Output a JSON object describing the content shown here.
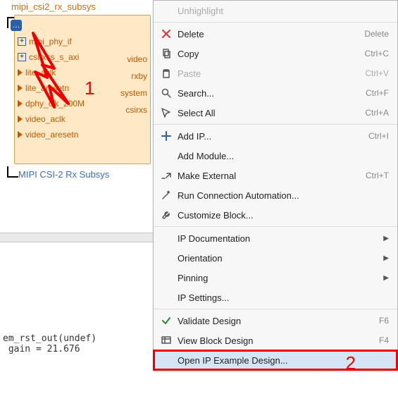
{
  "block": {
    "title": "mipi_csi2_rx_subsys",
    "badge": "…",
    "ports_left": [
      {
        "name": "mipi_phy_if",
        "plus": true
      },
      {
        "name": "csirxss_s_axi",
        "plus": true
      },
      {
        "name": "lite_aclk",
        "tri": true
      },
      {
        "name": "lite_aresetn",
        "tri": true
      },
      {
        "name": "dphy_clk_200M",
        "tri": true
      },
      {
        "name": "video_aclk",
        "tri": true
      },
      {
        "name": "video_aresetn",
        "tri": true
      }
    ],
    "ports_right": [
      "video",
      "rxby",
      "system",
      "csirxs"
    ],
    "footer": "MIPI CSI-2 Rx Subsys"
  },
  "annotation": {
    "label1": "1",
    "label2": "2"
  },
  "floater": "?",
  "code": {
    "line1": "em_rst_out(undef)",
    "line2": "gain = 21.676",
    "line3": ""
  },
  "menu": [
    {
      "type": "item",
      "icon": "",
      "label": "Unhighlight",
      "shortcut": "",
      "disabled": true
    },
    {
      "type": "sep"
    },
    {
      "type": "item",
      "icon": "x",
      "label": "Delete",
      "shortcut": "Delete"
    },
    {
      "type": "item",
      "icon": "copy",
      "label": "Copy",
      "shortcut": "Ctrl+C"
    },
    {
      "type": "item",
      "icon": "paste",
      "label": "Paste",
      "shortcut": "Ctrl+V",
      "disabled": true
    },
    {
      "type": "item",
      "icon": "search",
      "label": "Search...",
      "shortcut": "Ctrl+F"
    },
    {
      "type": "item",
      "icon": "select",
      "label": "Select All",
      "shortcut": "Ctrl+A"
    },
    {
      "type": "sep"
    },
    {
      "type": "item",
      "icon": "plus",
      "label": "Add IP...",
      "shortcut": "Ctrl+I"
    },
    {
      "type": "item",
      "icon": "",
      "label": "Add Module..."
    },
    {
      "type": "item",
      "icon": "ext",
      "label": "Make External",
      "shortcut": "Ctrl+T"
    },
    {
      "type": "item",
      "icon": "wand",
      "label": "Run Connection Automation..."
    },
    {
      "type": "item",
      "icon": "wrench",
      "label": "Customize Block..."
    },
    {
      "type": "sep"
    },
    {
      "type": "item",
      "icon": "",
      "label": "IP Documentation",
      "submenu": true
    },
    {
      "type": "item",
      "icon": "",
      "label": "Orientation",
      "submenu": true
    },
    {
      "type": "item",
      "icon": "",
      "label": "Pinning",
      "submenu": true
    },
    {
      "type": "item",
      "icon": "",
      "label": "IP Settings..."
    },
    {
      "type": "sep"
    },
    {
      "type": "item",
      "icon": "check",
      "label": "Validate Design",
      "shortcut": "F6"
    },
    {
      "type": "item",
      "icon": "view",
      "label": "View Block Design",
      "shortcut": "F4"
    },
    {
      "type": "item",
      "icon": "",
      "label": "Open IP Example Design...",
      "selected": true,
      "redbox": true
    }
  ]
}
